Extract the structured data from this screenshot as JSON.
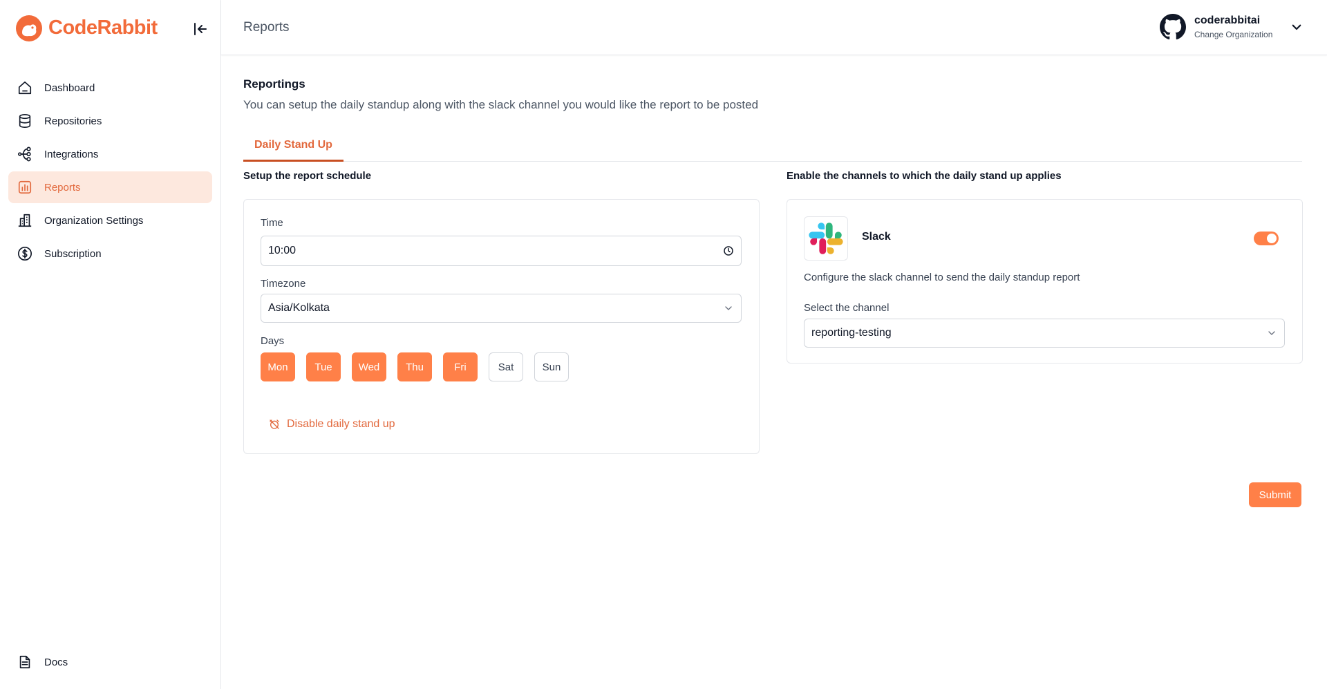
{
  "brand": {
    "name": "CodeRabbit",
    "accent": "#f26b3a"
  },
  "sidebar": {
    "items": [
      {
        "label": "Dashboard",
        "icon": "home-icon"
      },
      {
        "label": "Repositories",
        "icon": "database-icon"
      },
      {
        "label": "Integrations",
        "icon": "integrations-icon"
      },
      {
        "label": "Reports",
        "icon": "chart-icon",
        "active": true
      },
      {
        "label": "Organization Settings",
        "icon": "building-icon"
      },
      {
        "label": "Subscription",
        "icon": "dollar-circle-icon"
      }
    ],
    "bottom": {
      "label": "Docs",
      "icon": "document-icon"
    }
  },
  "header": {
    "title": "Reports",
    "org": {
      "name": "coderabbitai",
      "subtitle": "Change Organization",
      "icon": "github-icon"
    }
  },
  "main": {
    "title": "Reportings",
    "description": "You can setup the daily standup along with the slack channel you would like the report to be posted",
    "tabs": [
      {
        "label": "Daily Stand Up",
        "active": true
      }
    ],
    "schedule": {
      "section_title": "Setup the report schedule",
      "time_label": "Time",
      "time_value": "10:00",
      "timezone_label": "Timezone",
      "timezone_value": "Asia/Kolkata",
      "days_label": "Days",
      "days": [
        {
          "label": "Mon",
          "selected": true
        },
        {
          "label": "Tue",
          "selected": true
        },
        {
          "label": "Wed",
          "selected": true
        },
        {
          "label": "Thu",
          "selected": true
        },
        {
          "label": "Fri",
          "selected": true
        },
        {
          "label": "Sat",
          "selected": false
        },
        {
          "label": "Sun",
          "selected": false
        }
      ],
      "disable_label": "Disable daily stand up"
    },
    "channels": {
      "section_title": "Enable the channels to which the daily stand up applies",
      "slack": {
        "name": "Slack",
        "enabled": true,
        "description": "Configure the slack channel to send the daily standup report",
        "channel_label": "Select the channel",
        "channel_value": "reporting-testing"
      }
    },
    "submit_label": "Submit"
  }
}
